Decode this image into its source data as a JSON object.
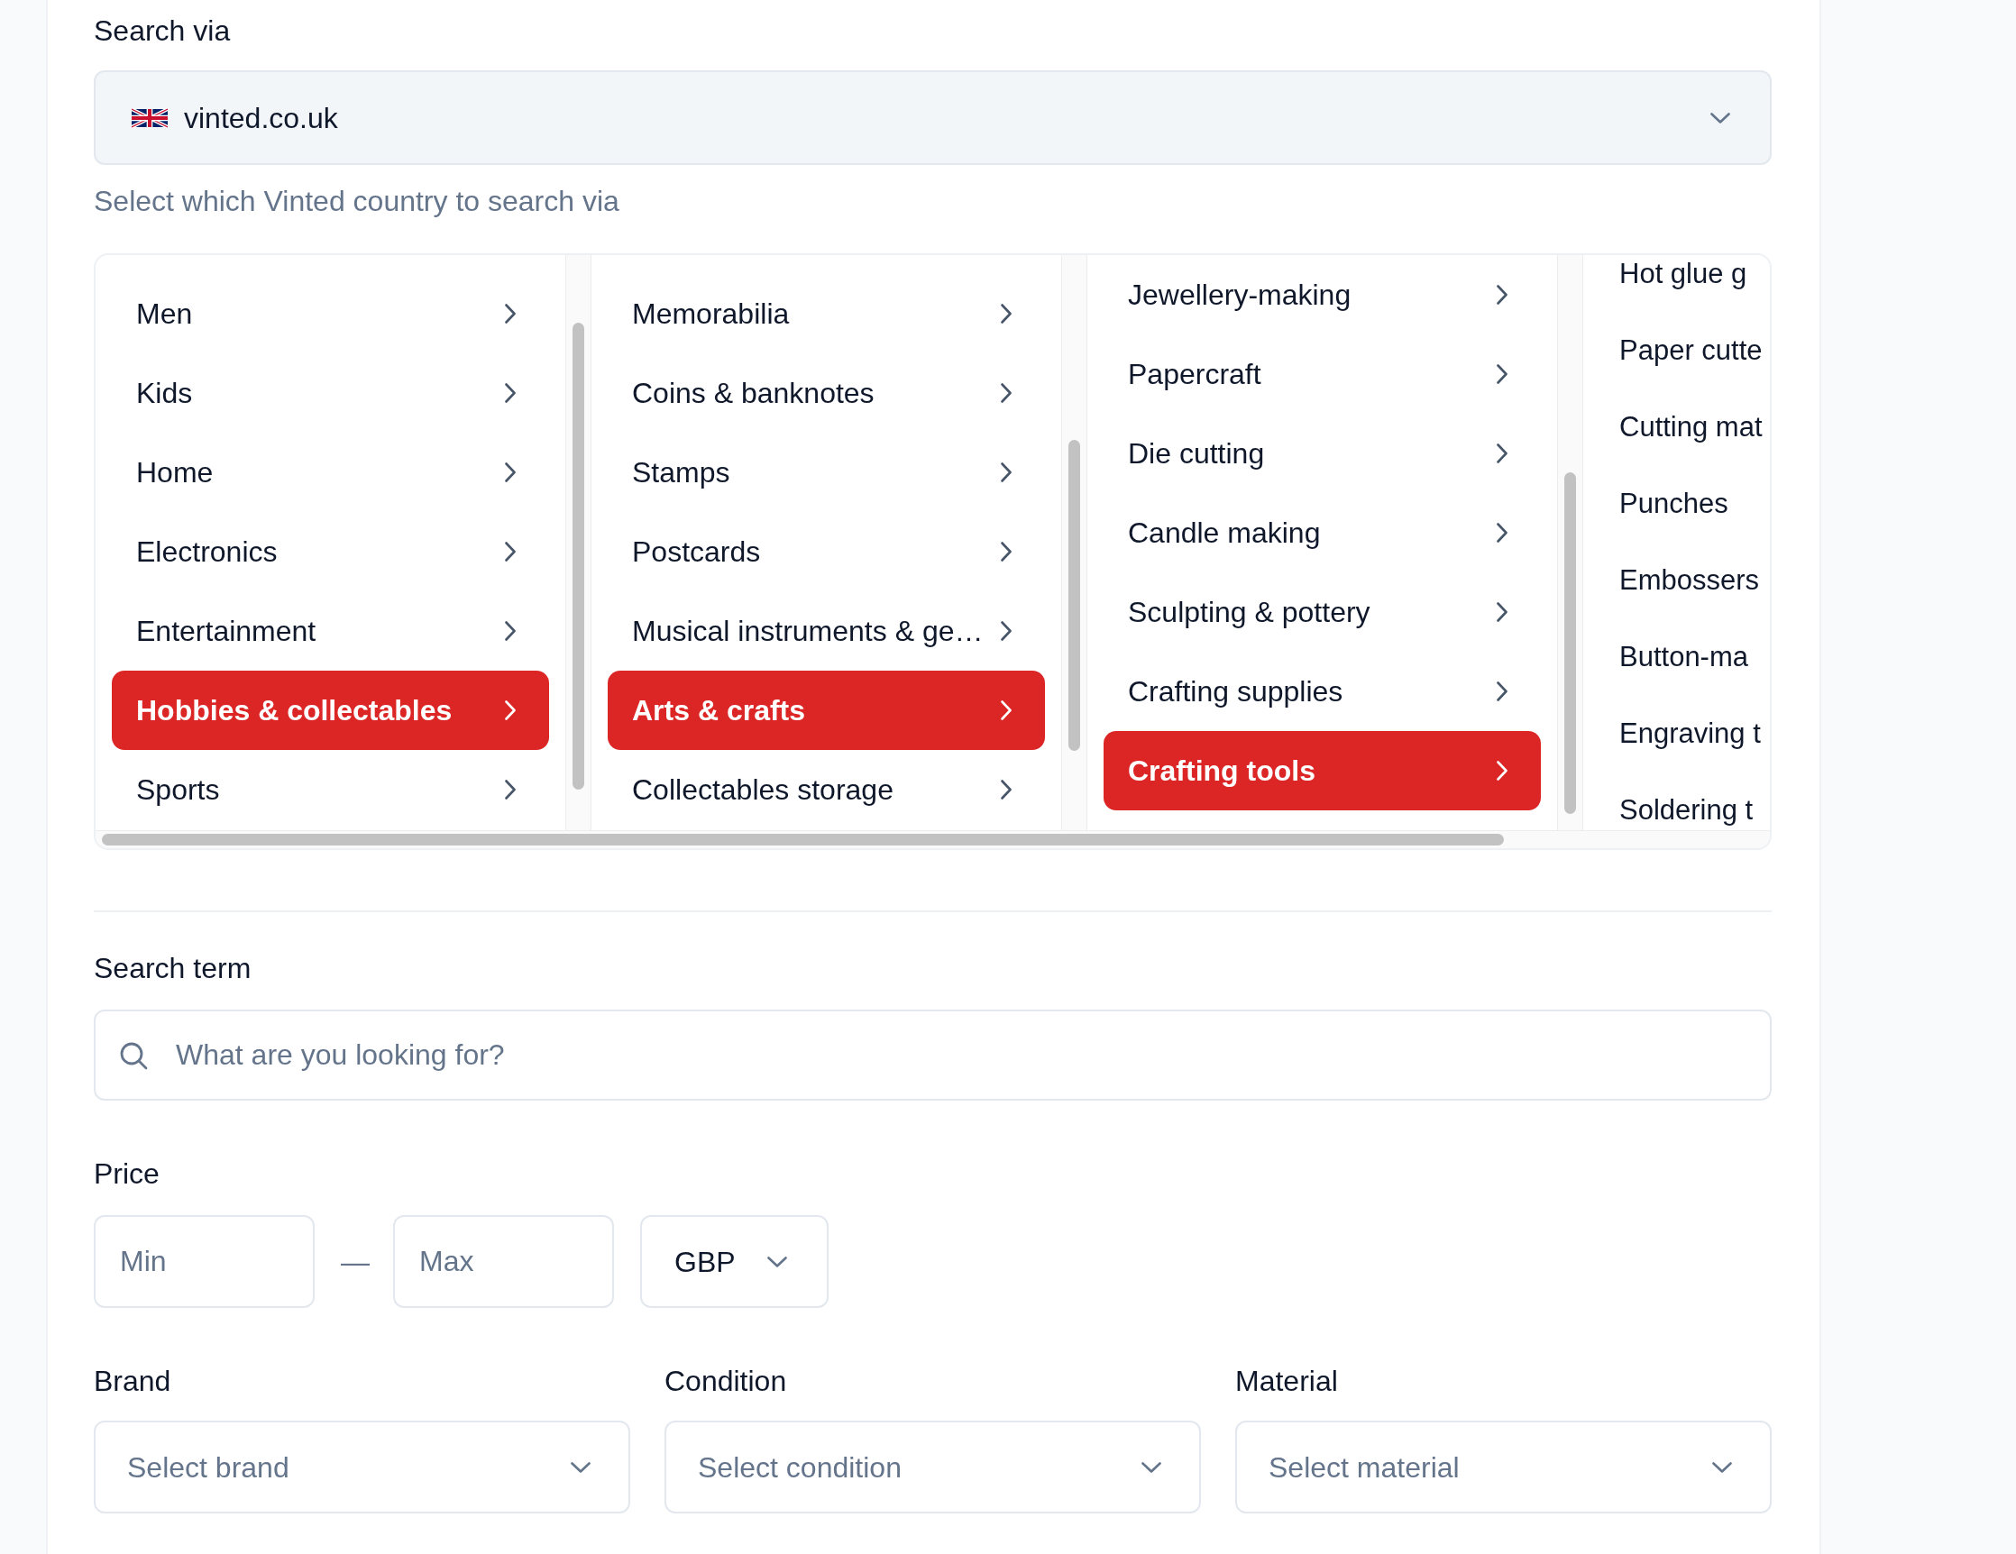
{
  "search_via": {
    "label": "Search via",
    "value": "vinted.co.uk",
    "hint": "Select which Vinted country to search via"
  },
  "category_columns": [
    {
      "items": [
        {
          "label": "Men",
          "kind": "branch",
          "selected": false
        },
        {
          "label": "Kids",
          "kind": "branch",
          "selected": false
        },
        {
          "label": "Home",
          "kind": "branch",
          "selected": false
        },
        {
          "label": "Electronics",
          "kind": "branch",
          "selected": false
        },
        {
          "label": "Entertainment",
          "kind": "branch",
          "selected": false
        },
        {
          "label": "Hobbies & collectables",
          "kind": "branch",
          "selected": true
        },
        {
          "label": "Sports",
          "kind": "branch",
          "selected": false
        }
      ]
    },
    {
      "items": [
        {
          "label": "Memorabilia",
          "kind": "branch",
          "selected": false
        },
        {
          "label": "Coins & banknotes",
          "kind": "branch",
          "selected": false
        },
        {
          "label": "Stamps",
          "kind": "branch",
          "selected": false
        },
        {
          "label": "Postcards",
          "kind": "branch",
          "selected": false
        },
        {
          "label": "Musical instruments & ge…",
          "kind": "branch",
          "selected": false
        },
        {
          "label": "Arts & crafts",
          "kind": "branch",
          "selected": true
        },
        {
          "label": "Collectables storage",
          "kind": "branch",
          "selected": false
        }
      ]
    },
    {
      "items": [
        {
          "label": "Jewellery-making",
          "kind": "branch",
          "selected": false
        },
        {
          "label": "Papercraft",
          "kind": "branch",
          "selected": false
        },
        {
          "label": "Die cutting",
          "kind": "branch",
          "selected": false
        },
        {
          "label": "Candle making",
          "kind": "branch",
          "selected": false
        },
        {
          "label": "Sculpting & pottery",
          "kind": "branch",
          "selected": false
        },
        {
          "label": "Crafting supplies",
          "kind": "branch",
          "selected": false
        },
        {
          "label": "Crafting tools",
          "kind": "branch",
          "selected": true
        }
      ]
    },
    {
      "items": [
        {
          "label": "Hot glue g",
          "kind": "leaf",
          "selected": false
        },
        {
          "label": "Paper cutte",
          "kind": "leaf",
          "selected": false
        },
        {
          "label": "Cutting mat",
          "kind": "leaf",
          "selected": false
        },
        {
          "label": "Punches",
          "kind": "leaf",
          "selected": false
        },
        {
          "label": "Embossers",
          "kind": "leaf",
          "selected": false
        },
        {
          "label": "Button-ma",
          "kind": "leaf",
          "selected": false
        },
        {
          "label": "Engraving t",
          "kind": "leaf",
          "selected": false
        },
        {
          "label": "Soldering t",
          "kind": "leaf",
          "selected": false
        }
      ]
    }
  ],
  "search_term": {
    "label": "Search term",
    "placeholder": "What are you looking for?"
  },
  "price": {
    "label": "Price",
    "min": {
      "placeholder": "Min"
    },
    "separator": "—",
    "max": {
      "placeholder": "Max"
    },
    "currency": {
      "value": "GBP"
    }
  },
  "filters": [
    {
      "label": "Brand",
      "placeholder": "Select brand"
    },
    {
      "label": "Condition",
      "placeholder": "Select condition"
    },
    {
      "label": "Material",
      "placeholder": "Select material"
    }
  ]
}
